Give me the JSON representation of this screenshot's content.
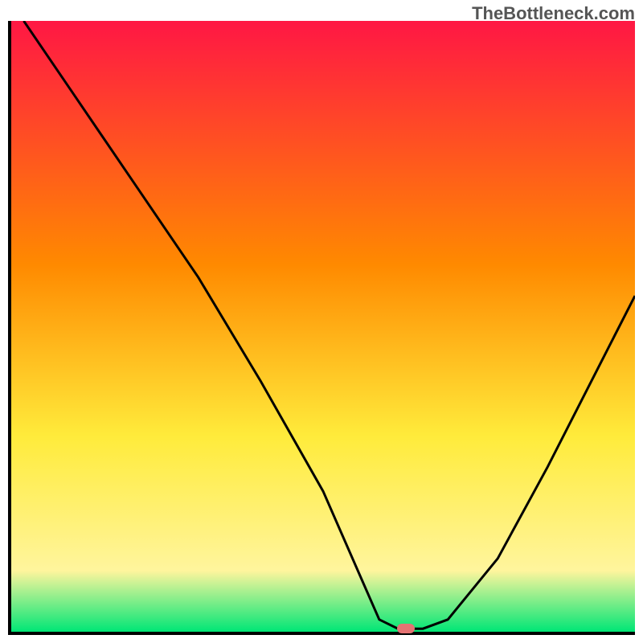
{
  "watermark": "TheBottleneck.com",
  "chart_data": {
    "type": "line",
    "title": "",
    "xlabel": "",
    "ylabel": "",
    "xlim": [
      0,
      100
    ],
    "ylim": [
      0,
      100
    ],
    "grid": false,
    "series": [
      {
        "name": "bottleneck-curve",
        "color": "#000000",
        "x": [
          2,
          10,
          20,
          30,
          40,
          50,
          56,
          59,
          62,
          66,
          70,
          78,
          86,
          94,
          100
        ],
        "values": [
          100,
          88,
          73,
          58,
          41,
          23,
          9,
          2,
          0.5,
          0.5,
          2,
          12,
          27,
          43,
          55
        ]
      }
    ],
    "background_gradient": {
      "top": "#ff1744",
      "mid1": "#ff8a00",
      "mid2": "#ffeb3b",
      "mid3": "#fff59d",
      "bottom": "#00e676"
    },
    "marker": {
      "x": 63,
      "y": 0.5,
      "color": "#e57373",
      "label": ""
    }
  }
}
